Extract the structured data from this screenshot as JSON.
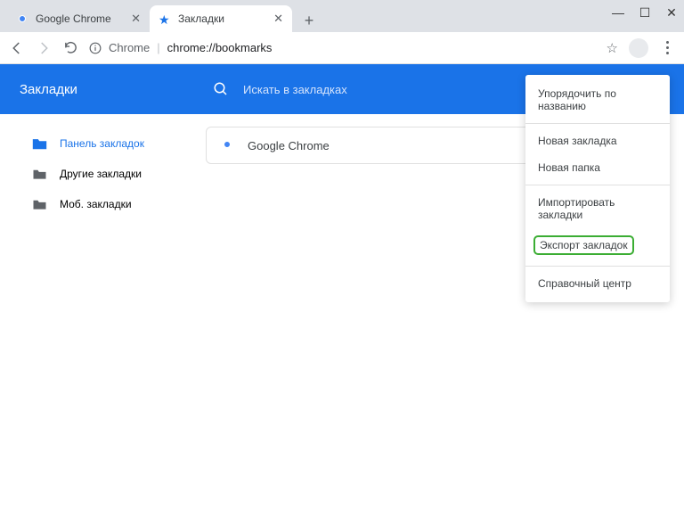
{
  "window": {
    "tabs": [
      {
        "label": "Google Chrome"
      },
      {
        "label": "Закладки"
      }
    ]
  },
  "address": {
    "prefix": "Chrome",
    "path": "chrome://bookmarks"
  },
  "header": {
    "title": "Закладки",
    "search_placeholder": "Искать в закладках"
  },
  "sidebar": {
    "items": [
      {
        "label": "Панель закладок"
      },
      {
        "label": "Другие закладки"
      },
      {
        "label": "Моб. закладки"
      }
    ]
  },
  "bookmarks": [
    {
      "title": "Google Chrome"
    }
  ],
  "menu": {
    "sort": "Упорядочить по названию",
    "new_bookmark": "Новая закладка",
    "new_folder": "Новая папка",
    "import": "Импортировать закладки",
    "export": "Экспорт закладок",
    "help": "Справочный центр"
  }
}
